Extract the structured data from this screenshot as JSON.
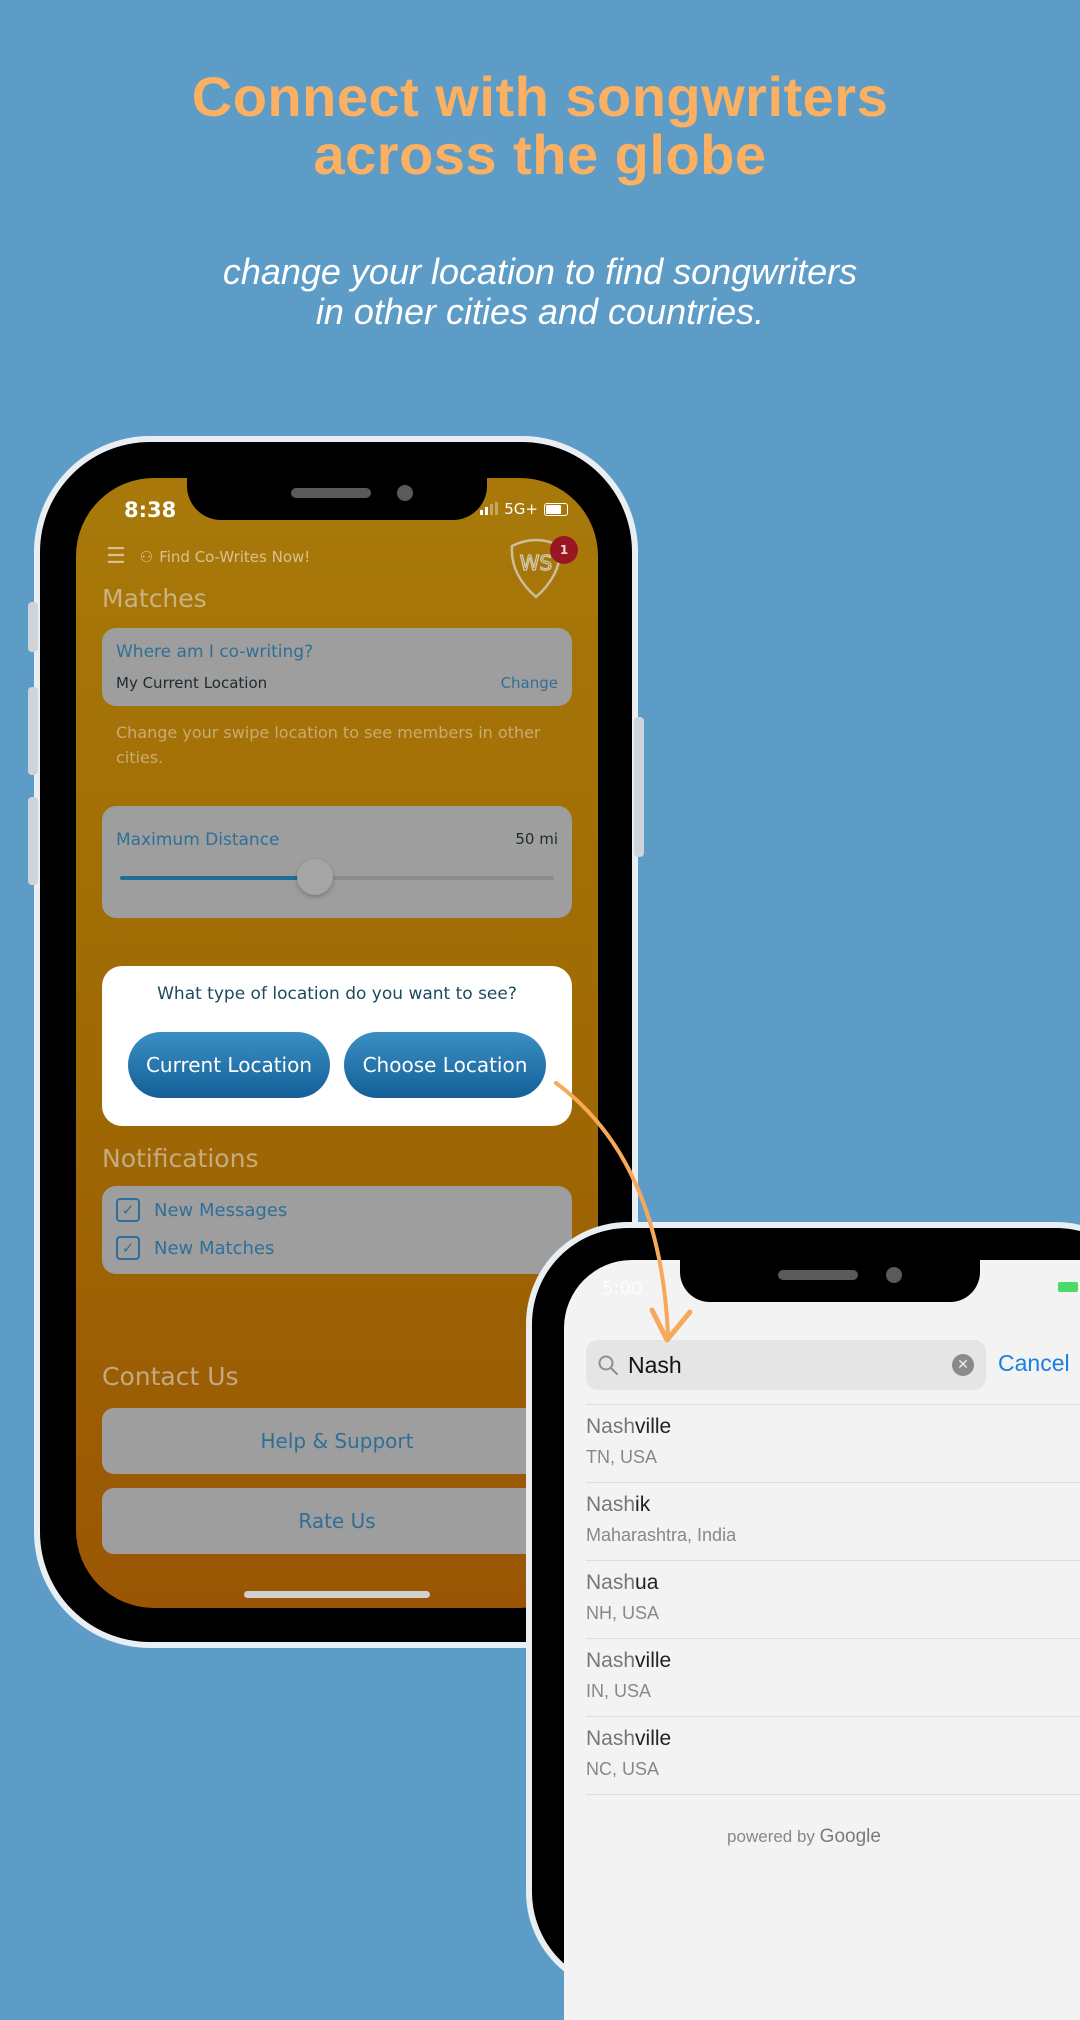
{
  "headline": {
    "line1": "Connect with songwriters",
    "line2": "across the globe"
  },
  "subline": {
    "line1": "change your location to find songwriters",
    "line2": "in other cities and countries."
  },
  "phone1": {
    "status": {
      "time": "8:38",
      "network": "5G+"
    },
    "nav": {
      "menu_icon": "list-icon",
      "find_label": "Find Co-Writes Now!",
      "logo_text": "WS",
      "badge_count": "1"
    },
    "matches": {
      "title": "Matches",
      "location_card": {
        "question": "Where am I co-writing?",
        "value": "My Current Location",
        "change_label": "Change"
      },
      "hint": "Change your swipe location to see members in other cities.",
      "distance": {
        "label": "Maximum Distance",
        "value": "50 mi",
        "fraction": 0.45
      }
    },
    "modal": {
      "question": "What type of location do you want to see?",
      "current_label": "Current Location",
      "choose_label": "Choose Location"
    },
    "notifications": {
      "title": "Notifications",
      "items": [
        {
          "label": "New Messages",
          "checked": true
        },
        {
          "label": "New Matches",
          "checked": true
        }
      ]
    },
    "contact": {
      "title": "Contact Us",
      "help_label": "Help & Support",
      "rate_label": "Rate Us"
    }
  },
  "phone2": {
    "status": {
      "time": "5:00"
    },
    "search": {
      "value": "Nash",
      "cancel_label": "Cancel"
    },
    "results": [
      {
        "match": "Nash",
        "rest": "ville",
        "sub": "TN, USA"
      },
      {
        "match": "Nash",
        "rest": "ik",
        "sub": "Maharashtra, India"
      },
      {
        "match": "Nash",
        "rest": "ua",
        "sub": "NH, USA"
      },
      {
        "match": "Nash",
        "rest": "ville",
        "sub": "IN, USA"
      },
      {
        "match": "Nash",
        "rest": "ville",
        "sub": "NC, USA"
      }
    ],
    "powered_by": "powered by",
    "powered_brand": "Google"
  },
  "colors": {
    "background": "#5e9cc8",
    "headline": "#fbb062",
    "accent_blue": "#1a7fe0",
    "app_orange": "#a8790a"
  }
}
